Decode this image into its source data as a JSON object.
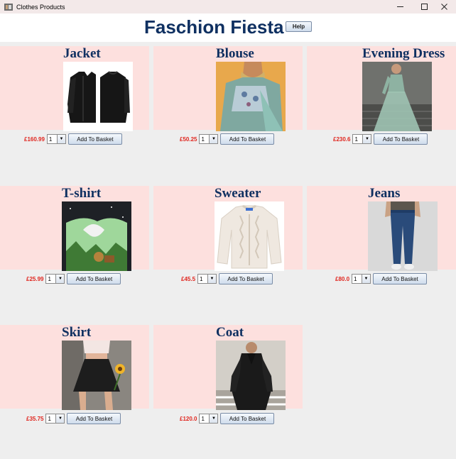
{
  "window": {
    "title": "Clothes Products",
    "icon": "app-icon"
  },
  "header": {
    "title": "Faschion Fiesta",
    "help_label": "Help"
  },
  "add_label": "Add To Basket",
  "products": [
    {
      "name": "Jacket",
      "price": "£160.99",
      "qty": "1",
      "image": "jacket-image"
    },
    {
      "name": "Blouse",
      "price": "£50.25",
      "qty": "1",
      "image": "blouse-image"
    },
    {
      "name": "Evening Dress",
      "price": "£230.6",
      "qty": "1",
      "image": "evening-dress-image"
    },
    {
      "name": "T-shirt",
      "price": "£25.99",
      "qty": "1",
      "image": "tshirt-image"
    },
    {
      "name": "Sweater",
      "price": "£45.5",
      "qty": "1",
      "image": "sweater-image"
    },
    {
      "name": "Jeans",
      "price": "£80.0",
      "qty": "1",
      "image": "jeans-image"
    },
    {
      "name": "Skirt",
      "price": "£35.75",
      "qty": "1",
      "image": "skirt-image"
    },
    {
      "name": "Coat",
      "price": "£120.0",
      "qty": "1",
      "image": "coat-image"
    }
  ]
}
